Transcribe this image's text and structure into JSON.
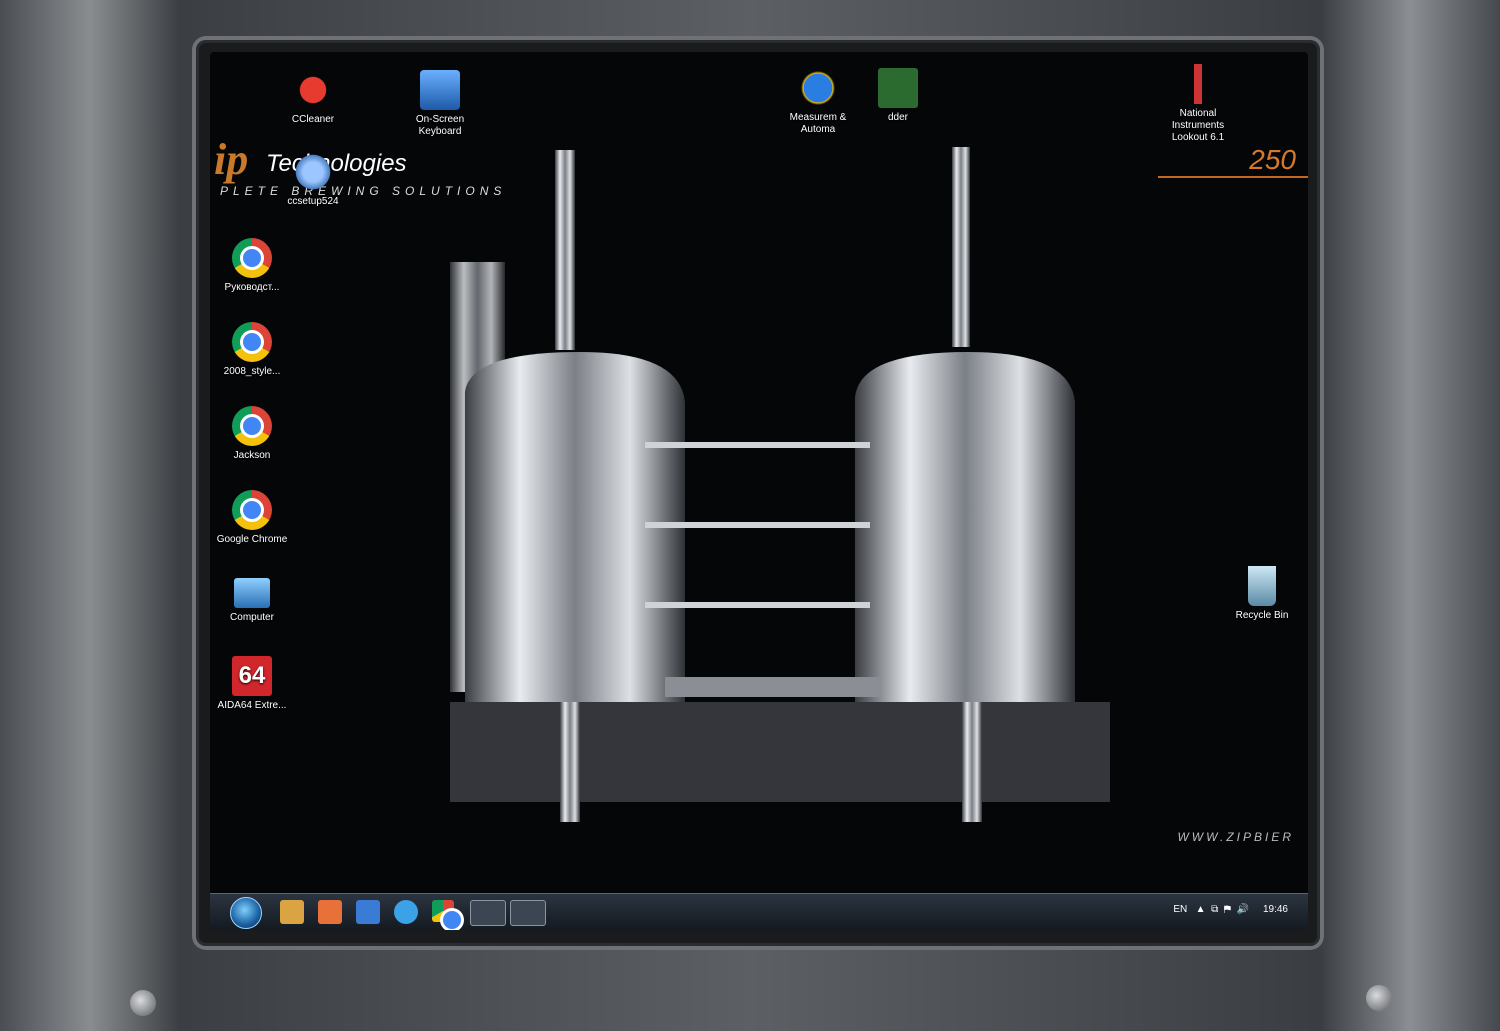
{
  "brand": {
    "logo": "ip",
    "name": "Technologies",
    "slogan": "PLETE BREWING SOLUTIONS",
    "model": "250",
    "website": "WWW.ZIPBIER"
  },
  "desktop_icons": [
    {
      "label": "CCleaner",
      "icon": "ccleaner-icon"
    },
    {
      "label": "On-Screen Keyboard",
      "icon": "keyboard-icon"
    },
    {
      "label": "Measurem & Automa",
      "icon": "measurement-icon"
    },
    {
      "label": "dder",
      "icon": "ladder-icon"
    },
    {
      "label": "National Instruments Lookout 6.1",
      "icon": "lighthouse-icon"
    },
    {
      "label": "ccsetup524",
      "icon": "installer-icon"
    },
    {
      "label": "Руководст...",
      "icon": "chrome-icon"
    },
    {
      "label": "2008_style...",
      "icon": "chrome-icon"
    },
    {
      "label": "Jackson",
      "icon": "chrome-icon"
    },
    {
      "label": "Google Chrome",
      "icon": "chrome-icon"
    },
    {
      "label": "Computer",
      "icon": "computer-icon"
    },
    {
      "label": "AIDA64 Extre...",
      "icon": "aida64-icon",
      "badge": "64"
    },
    {
      "label": "Recycle Bin",
      "icon": "recycle-bin-icon"
    }
  ],
  "taskbar": {
    "lang": "EN",
    "clock": "19:46"
  },
  "colors": {
    "accent": "#d47a2a",
    "desktop": "#050608"
  }
}
